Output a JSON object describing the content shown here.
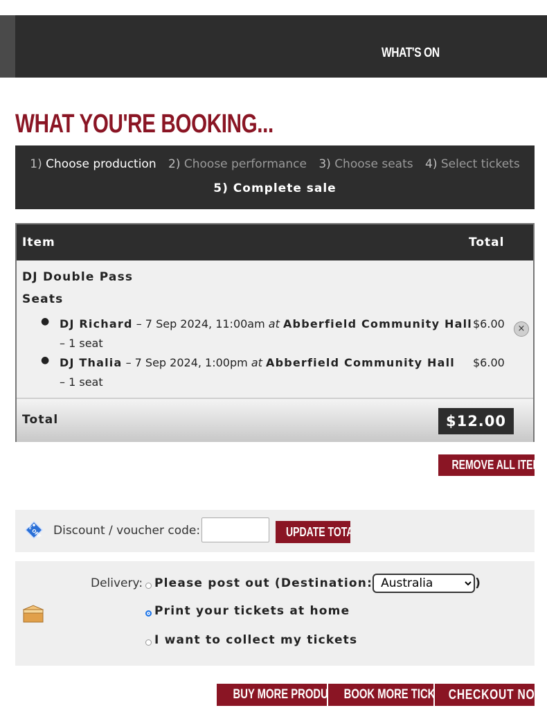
{
  "nav": {
    "whats_on": "WHAT'S ON"
  },
  "page_title": "WHAT YOU'RE BOOKING...",
  "steps": [
    {
      "num": "1)",
      "label": "Choose production"
    },
    {
      "num": "2)",
      "label": "Choose performance"
    },
    {
      "num": "3)",
      "label": "Choose seats"
    },
    {
      "num": "4)",
      "label": "Select tickets"
    },
    {
      "num": "5)",
      "label": "Complete sale"
    }
  ],
  "cart": {
    "col_item": "Item",
    "col_total": "Total",
    "product": "DJ Double Pass",
    "seats_heading": "Seats",
    "items": [
      {
        "performer": "DJ Richard",
        "when": " – 7 Sep 2024, 11:00am ",
        "at": "at",
        "venue": "Abberfield Community Hall",
        "qty": " – 1 seat",
        "price": "$6.00"
      },
      {
        "performer": "DJ Thalia",
        "when": " – 7 Sep 2024, 1:00pm ",
        "at": "at",
        "venue": "Abberfield Community Hall",
        "qty": " – 1 seat",
        "price": "$6.00"
      }
    ],
    "remove_icon": "×",
    "total_label": "Total",
    "total_amount": "$12.00"
  },
  "remove_all_label": "REMOVE ALL ITEMS",
  "voucher": {
    "label": "Discount / voucher code:",
    "value": "",
    "update_label": "UPDATE TOTAL",
    "tag_text": "% OFF"
  },
  "delivery": {
    "label": "Delivery:",
    "post_label": "Please post out (Destination:",
    "destination": "Australia",
    "post_close": ")",
    "print_label": "Print your tickets at home",
    "collect_label": "I want to collect my tickets",
    "selected": "print"
  },
  "buttons": {
    "buy_more": "BUY MORE PRODUCTS",
    "book_more": "BOOK MORE TICKETS",
    "checkout": "CHECKOUT NOW"
  },
  "colors": {
    "accent": "#8a1524",
    "dark": "#2d2d2d",
    "panel": "#efefef"
  }
}
